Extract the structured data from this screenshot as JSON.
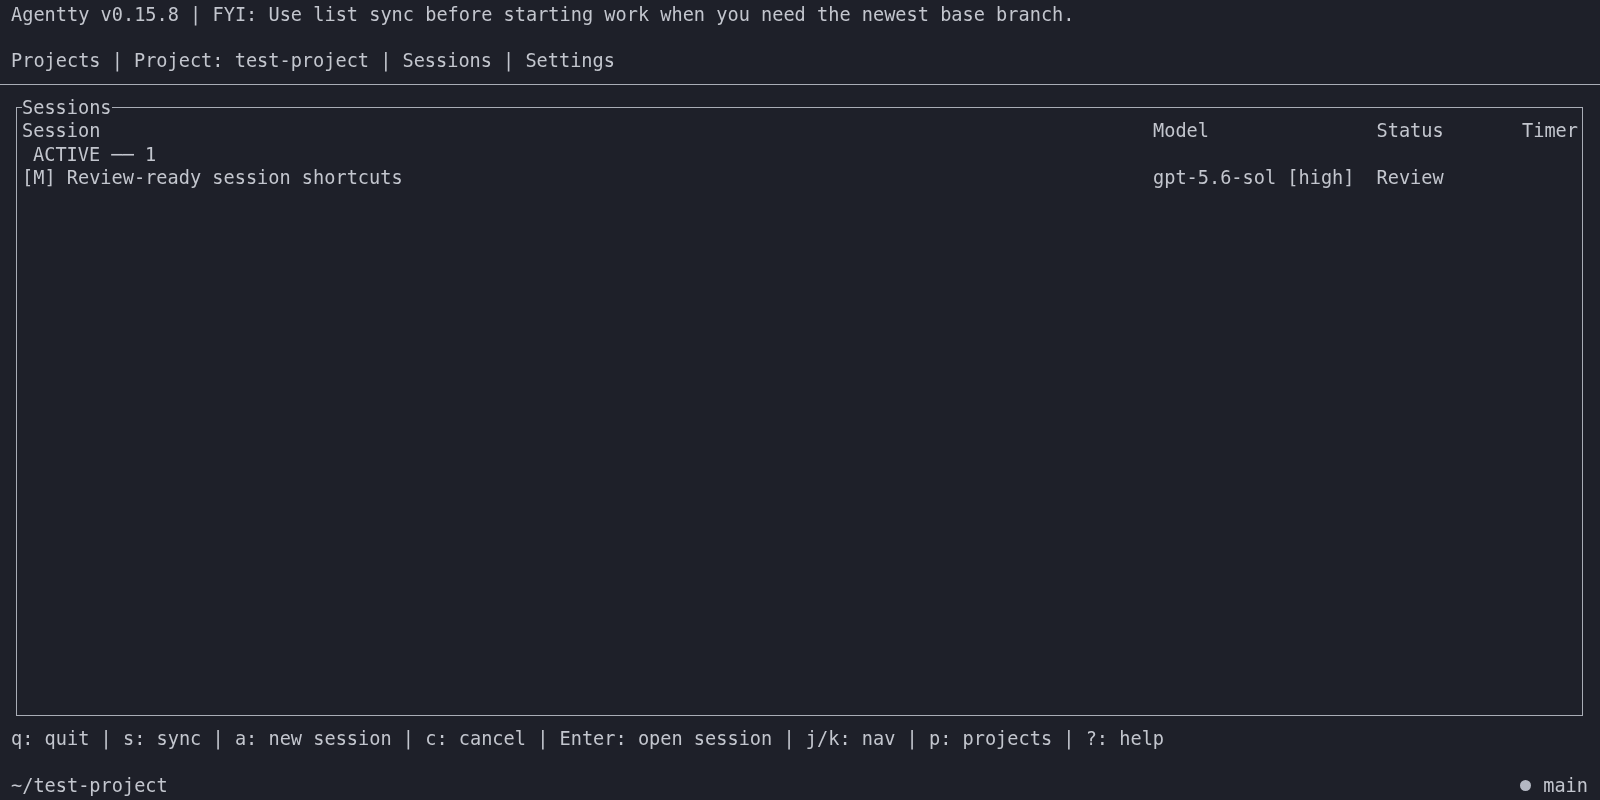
{
  "title_bar": {
    "text": "Agentty v0.15.8 | FYI: Use list sync before starting work when you need the newest base branch."
  },
  "nav": {
    "separator": "|",
    "tabs": [
      {
        "label": "Projects"
      },
      {
        "label": "Project: test-project"
      },
      {
        "label": "Sessions"
      },
      {
        "label": "Settings"
      }
    ]
  },
  "sessions_panel": {
    "title": "Sessions",
    "columns": [
      "Session",
      "Model",
      "Status",
      "Timer"
    ],
    "groups": [
      {
        "label": "ACTIVE ── 1",
        "rows": [
          {
            "session": "[M] Review-ready session shortcuts",
            "model": "gpt-5.6-sol [high]",
            "status": "Review"
          }
        ]
      }
    ]
  },
  "help_bar": {
    "text": "q: quit | s: sync | a: new session | c: cancel | Enter: open session | j/k: nav | p: projects | ?: help"
  },
  "status_bar": {
    "path": "~/test-project",
    "branch": "main"
  }
}
